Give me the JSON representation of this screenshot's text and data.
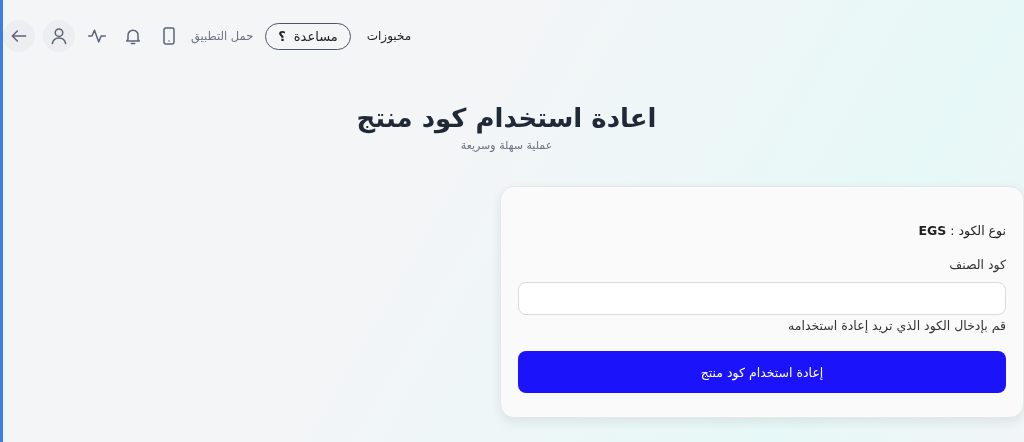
{
  "top_bar": {
    "brand": "مخبوزات",
    "help_button": {
      "label": "مساعدة",
      "mark": "؟"
    },
    "download_app": "حمل التطبيق"
  },
  "hero": {
    "title": "اعادة استخدام كود منتج",
    "subtitle": "عملية سهلة وسريعة"
  },
  "form": {
    "code_type": "نوع الكود : **EGS**",
    "field_label": "كود الصنف",
    "hint": "قم بإدخال الكود الذي تريد إعادة استخدامه",
    "submit": "إعادة استخدام كود منتج"
  }
}
